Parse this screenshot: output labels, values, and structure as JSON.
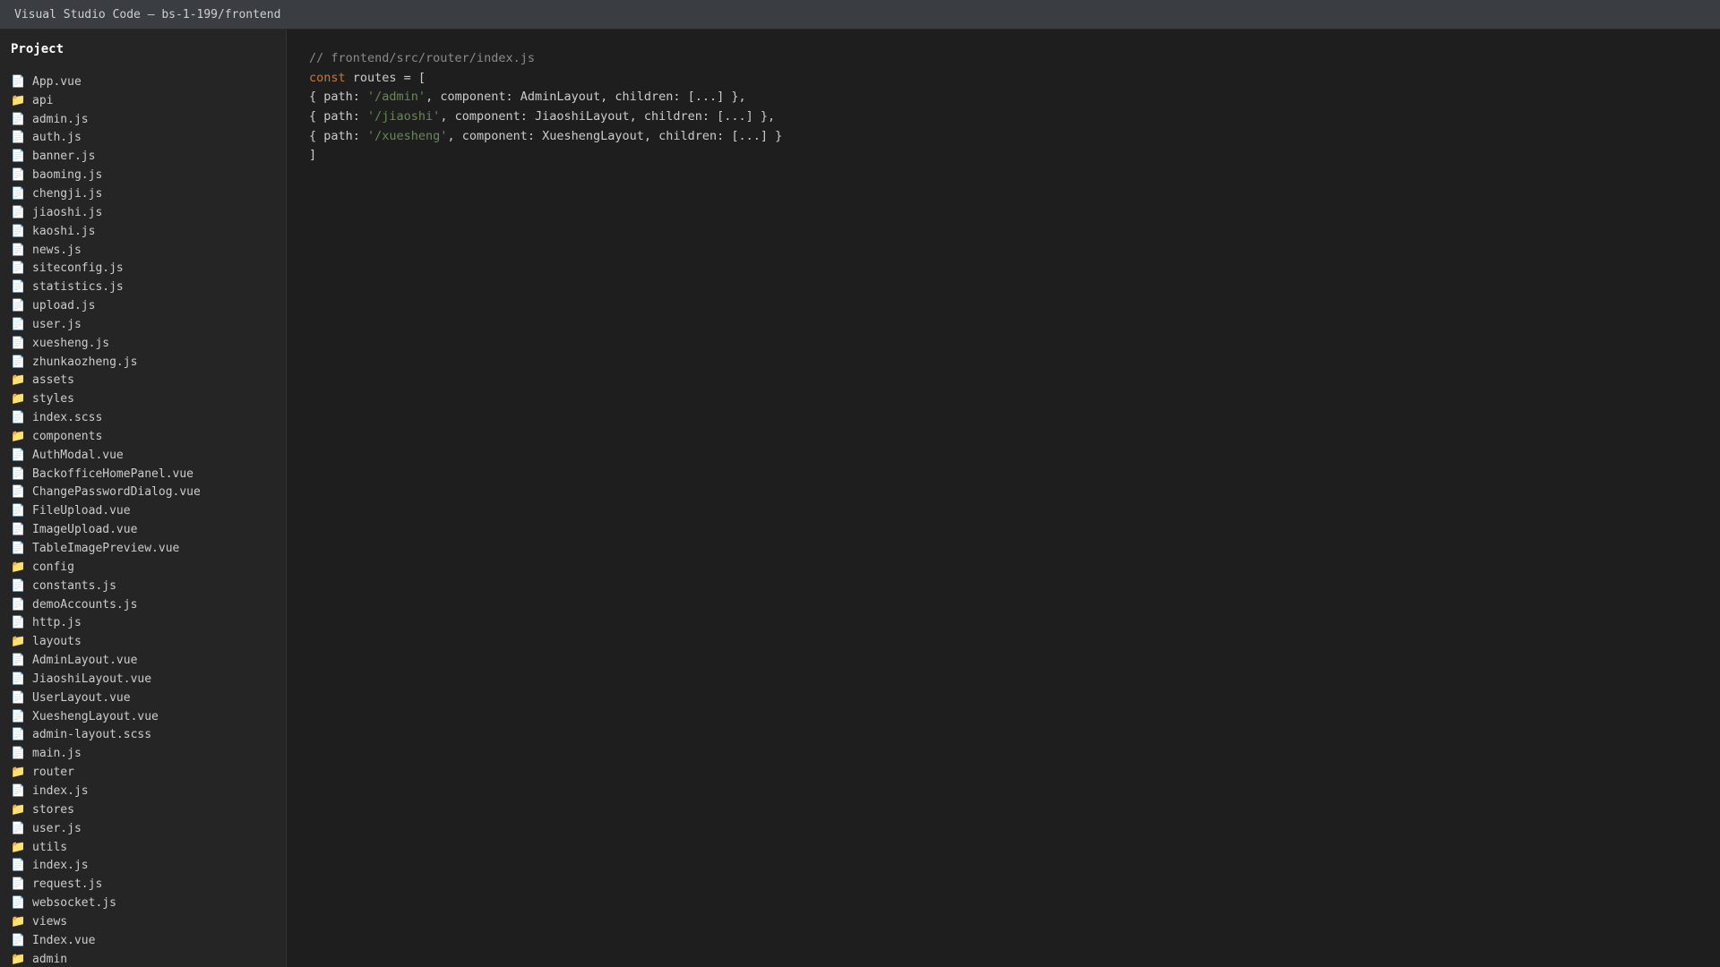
{
  "window": {
    "title": "Visual Studio Code — bs-1-199/frontend"
  },
  "sidebar": {
    "header": "Project",
    "items": [
      {
        "type": "file",
        "icon": "file-icon",
        "label": "App.vue"
      },
      {
        "type": "folder",
        "icon": "folder-icon",
        "label": "api"
      },
      {
        "type": "file",
        "icon": "file-icon",
        "label": "admin.js"
      },
      {
        "type": "file",
        "icon": "file-icon",
        "label": "auth.js"
      },
      {
        "type": "file",
        "icon": "file-icon",
        "label": "banner.js"
      },
      {
        "type": "file",
        "icon": "file-icon",
        "label": "baoming.js"
      },
      {
        "type": "file",
        "icon": "file-icon",
        "label": "chengji.js"
      },
      {
        "type": "file",
        "icon": "file-icon",
        "label": "jiaoshi.js"
      },
      {
        "type": "file",
        "icon": "file-icon",
        "label": "kaoshi.js"
      },
      {
        "type": "file",
        "icon": "file-icon",
        "label": "news.js"
      },
      {
        "type": "file",
        "icon": "file-icon",
        "label": "siteconfig.js"
      },
      {
        "type": "file",
        "icon": "file-icon",
        "label": "statistics.js"
      },
      {
        "type": "file",
        "icon": "file-icon",
        "label": "upload.js"
      },
      {
        "type": "file",
        "icon": "file-icon",
        "label": "user.js"
      },
      {
        "type": "file",
        "icon": "file-icon",
        "label": "xuesheng.js"
      },
      {
        "type": "file",
        "icon": "file-icon",
        "label": "zhunkaozheng.js"
      },
      {
        "type": "folder",
        "icon": "folder-icon",
        "label": "assets"
      },
      {
        "type": "folder",
        "icon": "folder-icon",
        "label": "styles"
      },
      {
        "type": "file",
        "icon": "file-icon",
        "label": "index.scss"
      },
      {
        "type": "folder",
        "icon": "folder-icon",
        "label": "components"
      },
      {
        "type": "file",
        "icon": "file-icon",
        "label": "AuthModal.vue"
      },
      {
        "type": "file",
        "icon": "file-icon",
        "label": "BackofficeHomePanel.vue"
      },
      {
        "type": "file",
        "icon": "file-icon",
        "label": "ChangePasswordDialog.vue"
      },
      {
        "type": "file",
        "icon": "file-icon",
        "label": "FileUpload.vue"
      },
      {
        "type": "file",
        "icon": "file-icon",
        "label": "ImageUpload.vue"
      },
      {
        "type": "file",
        "icon": "file-icon",
        "label": "TableImagePreview.vue"
      },
      {
        "type": "folder",
        "icon": "folder-icon",
        "label": "config"
      },
      {
        "type": "file",
        "icon": "file-icon",
        "label": "constants.js"
      },
      {
        "type": "file",
        "icon": "file-icon",
        "label": "demoAccounts.js"
      },
      {
        "type": "file",
        "icon": "file-icon",
        "label": "http.js"
      },
      {
        "type": "folder",
        "icon": "folder-icon",
        "label": "layouts"
      },
      {
        "type": "file",
        "icon": "file-icon",
        "label": "AdminLayout.vue"
      },
      {
        "type": "file",
        "icon": "file-icon",
        "label": "JiaoshiLayout.vue"
      },
      {
        "type": "file",
        "icon": "file-icon",
        "label": "UserLayout.vue"
      },
      {
        "type": "file",
        "icon": "file-icon",
        "label": "XueshengLayout.vue"
      },
      {
        "type": "file",
        "icon": "file-icon",
        "label": "admin-layout.scss"
      },
      {
        "type": "file",
        "icon": "file-icon",
        "label": "main.js"
      },
      {
        "type": "folder",
        "icon": "folder-icon",
        "label": "router"
      },
      {
        "type": "file",
        "icon": "file-icon",
        "label": "index.js"
      },
      {
        "type": "folder",
        "icon": "folder-icon",
        "label": "stores"
      },
      {
        "type": "file",
        "icon": "file-icon",
        "label": "user.js"
      },
      {
        "type": "folder",
        "icon": "folder-icon",
        "label": "utils"
      },
      {
        "type": "file",
        "icon": "file-icon",
        "label": "index.js"
      },
      {
        "type": "file",
        "icon": "file-icon",
        "label": "request.js"
      },
      {
        "type": "file",
        "icon": "file-icon",
        "label": "websocket.js"
      },
      {
        "type": "folder",
        "icon": "folder-icon",
        "label": "views"
      },
      {
        "type": "file",
        "icon": "file-icon",
        "label": "Index.vue"
      },
      {
        "type": "folder",
        "icon": "folder-icon",
        "label": "admin"
      }
    ]
  },
  "editor": {
    "lines": [
      [
        {
          "kind": "comment",
          "text": "// frontend/src/router/index.js"
        }
      ],
      [
        {
          "kind": "keyword",
          "text": "const"
        },
        {
          "kind": "plain",
          "text": " routes = ["
        }
      ],
      [
        {
          "kind": "plain",
          "text": "{ path: "
        },
        {
          "kind": "string",
          "text": "'/admin'"
        },
        {
          "kind": "plain",
          "text": ", component: AdminLayout, children: [...] },"
        }
      ],
      [
        {
          "kind": "plain",
          "text": "{ path: "
        },
        {
          "kind": "string",
          "text": "'/jiaoshi'"
        },
        {
          "kind": "plain",
          "text": ", component: JiaoshiLayout, children: [...] },"
        }
      ],
      [
        {
          "kind": "plain",
          "text": "{ path: "
        },
        {
          "kind": "string",
          "text": "'/xuesheng'"
        },
        {
          "kind": "plain",
          "text": ", component: XueshengLayout, children: [...] }"
        }
      ],
      [
        {
          "kind": "plain",
          "text": "]"
        }
      ]
    ]
  },
  "colors": {
    "keyword": "#cc7832",
    "string": "#6a8759",
    "comment": "#8a8a8a",
    "text": "#cccccc",
    "folder_icon": "#e8b83a",
    "file_icon": "#e8e8e8"
  }
}
